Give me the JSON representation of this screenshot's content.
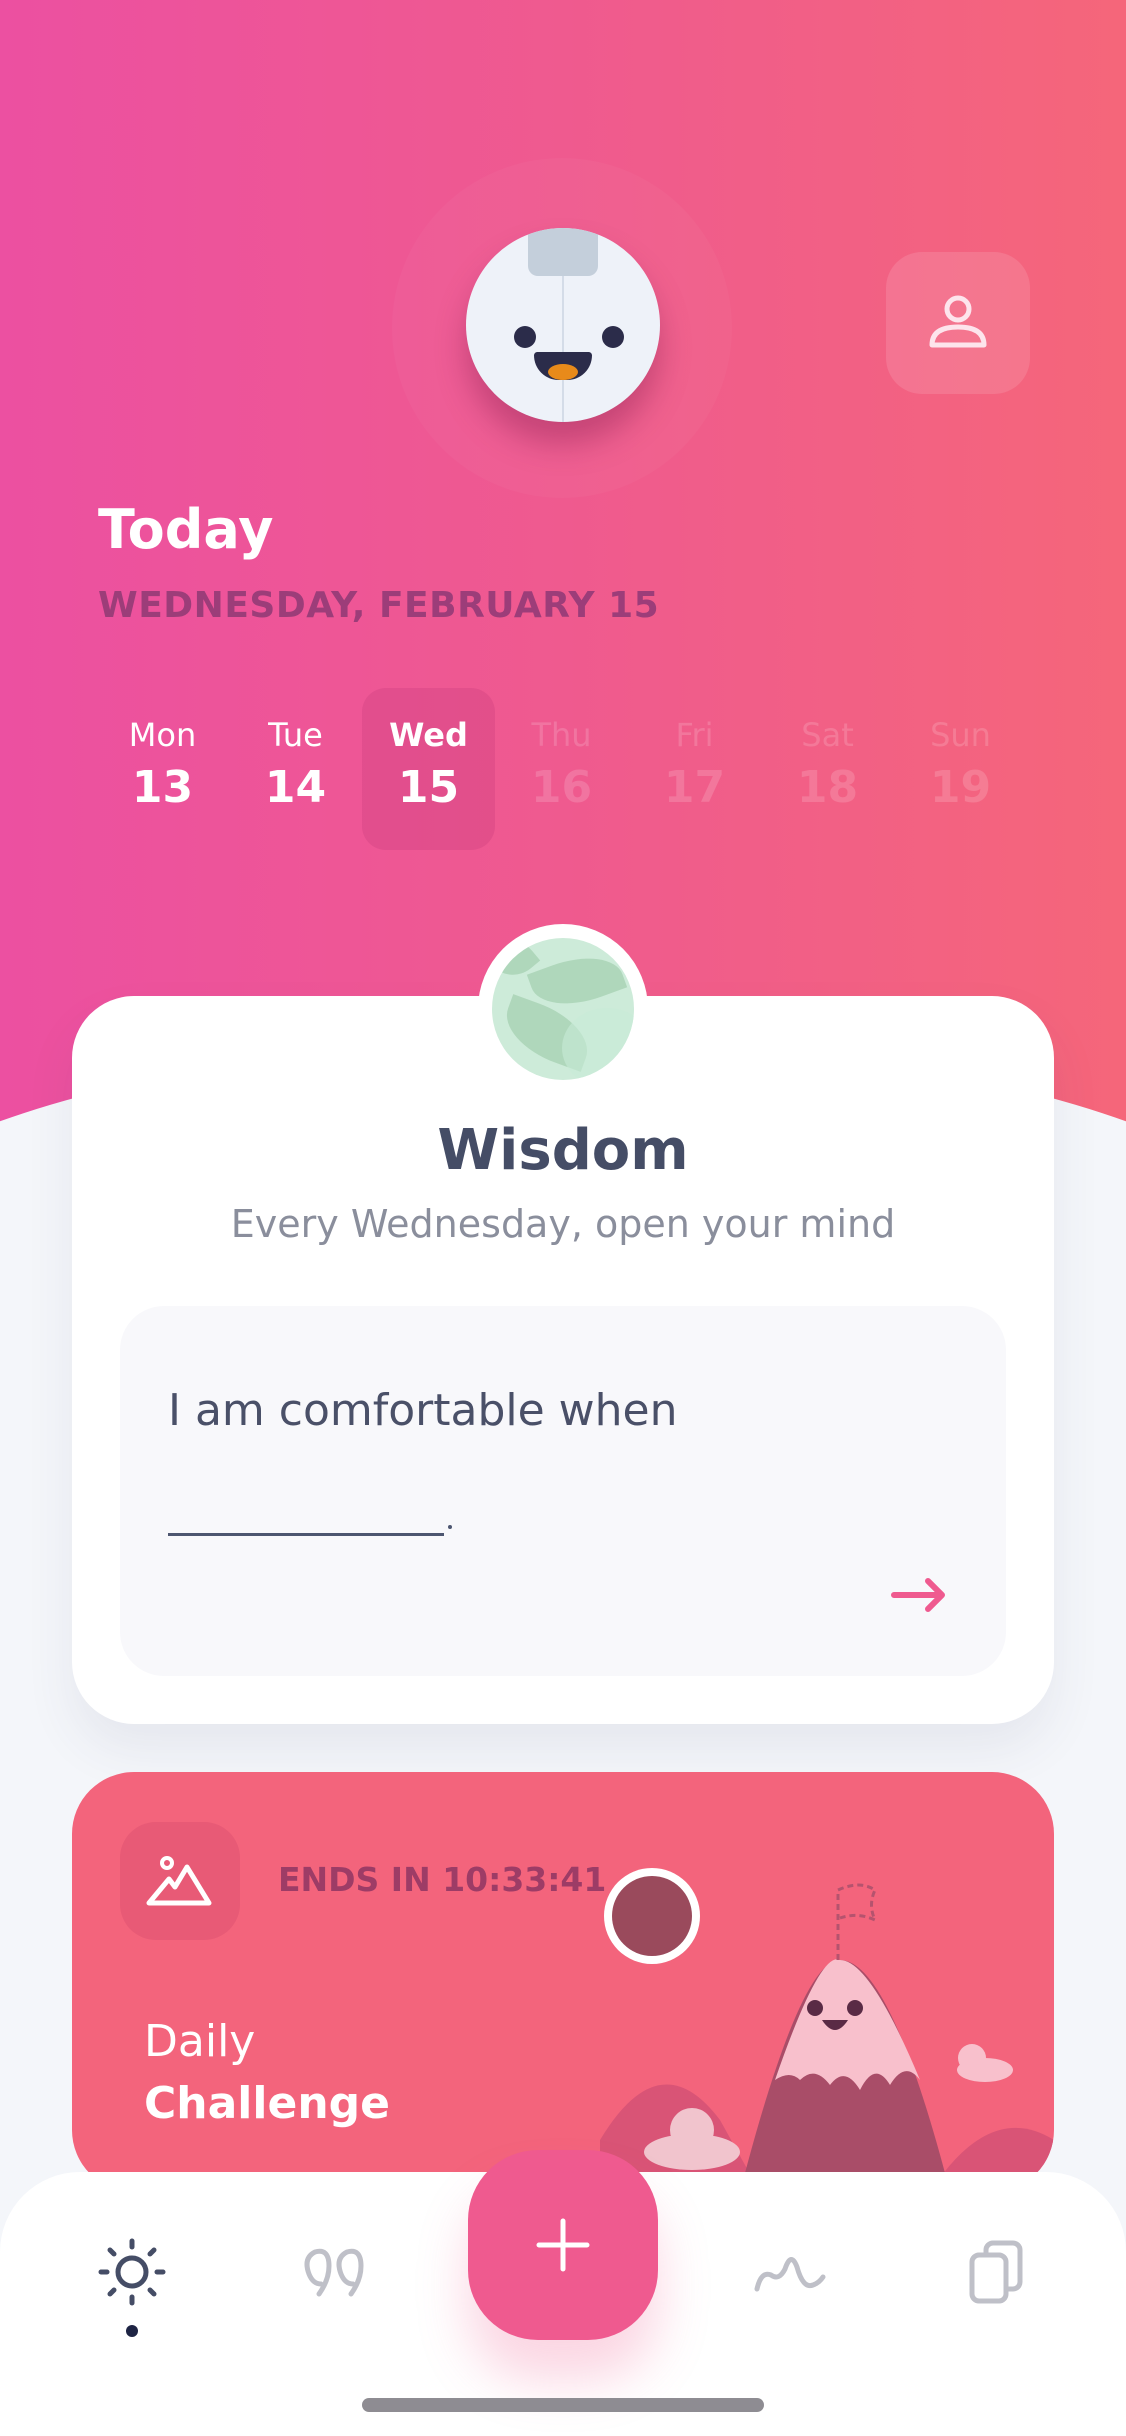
{
  "header": {
    "title": "Today",
    "date_label": "WEDNESDAY, FEBRUARY 15",
    "mascot": "robot-mascot",
    "profile_icon": "user-icon"
  },
  "week": {
    "days": [
      {
        "name": "Mon",
        "date": "13",
        "state": "past"
      },
      {
        "name": "Tue",
        "date": "14",
        "state": "past"
      },
      {
        "name": "Wed",
        "date": "15",
        "state": "selected"
      },
      {
        "name": "Thu",
        "date": "16",
        "state": "future"
      },
      {
        "name": "Fri",
        "date": "17",
        "state": "future"
      },
      {
        "name": "Sat",
        "date": "18",
        "state": "future"
      },
      {
        "name": "Sun",
        "date": "19",
        "state": "future"
      }
    ]
  },
  "wisdom_card": {
    "badge_icon": "leaves-icon",
    "title": "Wisdom",
    "subtitle": "Every Wednesday, open your mind",
    "prompt": "I am comfortable when",
    "blank_suffix": ".",
    "next_icon": "arrow-right-icon"
  },
  "challenge_card": {
    "icon": "mountain-icon",
    "ends_in": "ENDS IN 10:33:41",
    "label_line1": "Daily",
    "label_line2": "Challenge"
  },
  "tabbar": {
    "items": [
      {
        "name": "today",
        "icon": "sun-icon",
        "active": true
      },
      {
        "name": "quotes",
        "icon": "quote-icon",
        "active": false
      },
      {
        "name": "add",
        "icon": "plus-icon",
        "active": false
      },
      {
        "name": "insights",
        "icon": "wave-icon",
        "active": false
      },
      {
        "name": "entries",
        "icon": "cards-icon",
        "active": false
      }
    ]
  },
  "colors": {
    "gradient_start": "#ec50a1",
    "gradient_end": "#f5667a",
    "accent": "#ef5a8f",
    "date_label": "#9c3d79",
    "card_title": "#454d66",
    "challenge_bg": "#f3647c",
    "tab_active": "#454d66",
    "tab_inactive": "#bfc0c8"
  }
}
